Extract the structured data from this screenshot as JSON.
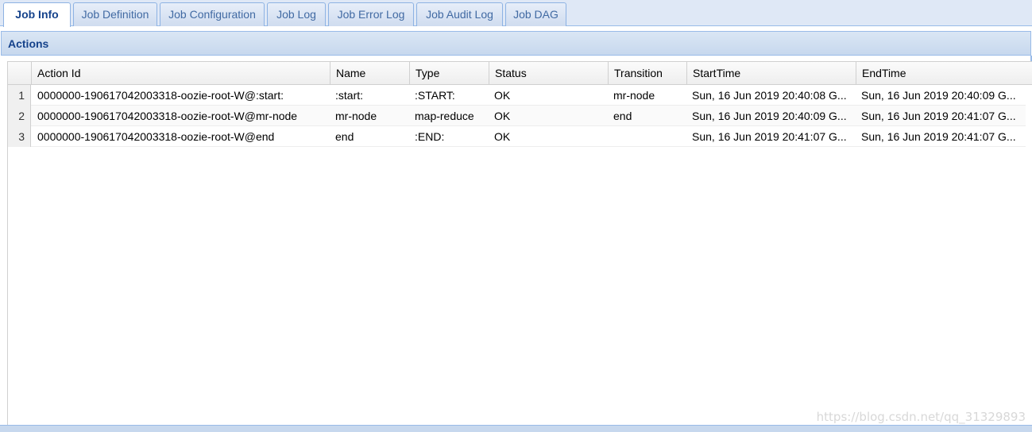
{
  "tabs": [
    {
      "label": "Job Info",
      "active": true
    },
    {
      "label": "Job Definition",
      "active": false
    },
    {
      "label": "Job Configuration",
      "active": false
    },
    {
      "label": "Job Log",
      "active": false
    },
    {
      "label": "Job Error Log",
      "active": false
    },
    {
      "label": "Job Audit Log",
      "active": false
    },
    {
      "label": "Job DAG",
      "active": false
    }
  ],
  "panel": {
    "title": "Actions"
  },
  "grid": {
    "columns": [
      "Action Id",
      "Name",
      "Type",
      "Status",
      "Transition",
      "StartTime",
      "EndTime"
    ],
    "rows": [
      {
        "num": "1",
        "cells": [
          "0000000-190617042003318-oozie-root-W@:start:",
          ":start:",
          ":START:",
          "OK",
          "mr-node",
          "Sun, 16 Jun 2019 20:40:08 G...",
          "Sun, 16 Jun 2019 20:40:09 G..."
        ]
      },
      {
        "num": "2",
        "cells": [
          "0000000-190617042003318-oozie-root-W@mr-node",
          "mr-node",
          "map-reduce",
          "OK",
          "end",
          "Sun, 16 Jun 2019 20:40:09 G...",
          "Sun, 16 Jun 2019 20:41:07 G..."
        ]
      },
      {
        "num": "3",
        "cells": [
          "0000000-190617042003318-oozie-root-W@end",
          "end",
          ":END:",
          "OK",
          "",
          "Sun, 16 Jun 2019 20:41:07 G...",
          "Sun, 16 Jun 2019 20:41:07 G..."
        ]
      }
    ]
  },
  "watermark": "https://blog.csdn.net/qq_31329893"
}
